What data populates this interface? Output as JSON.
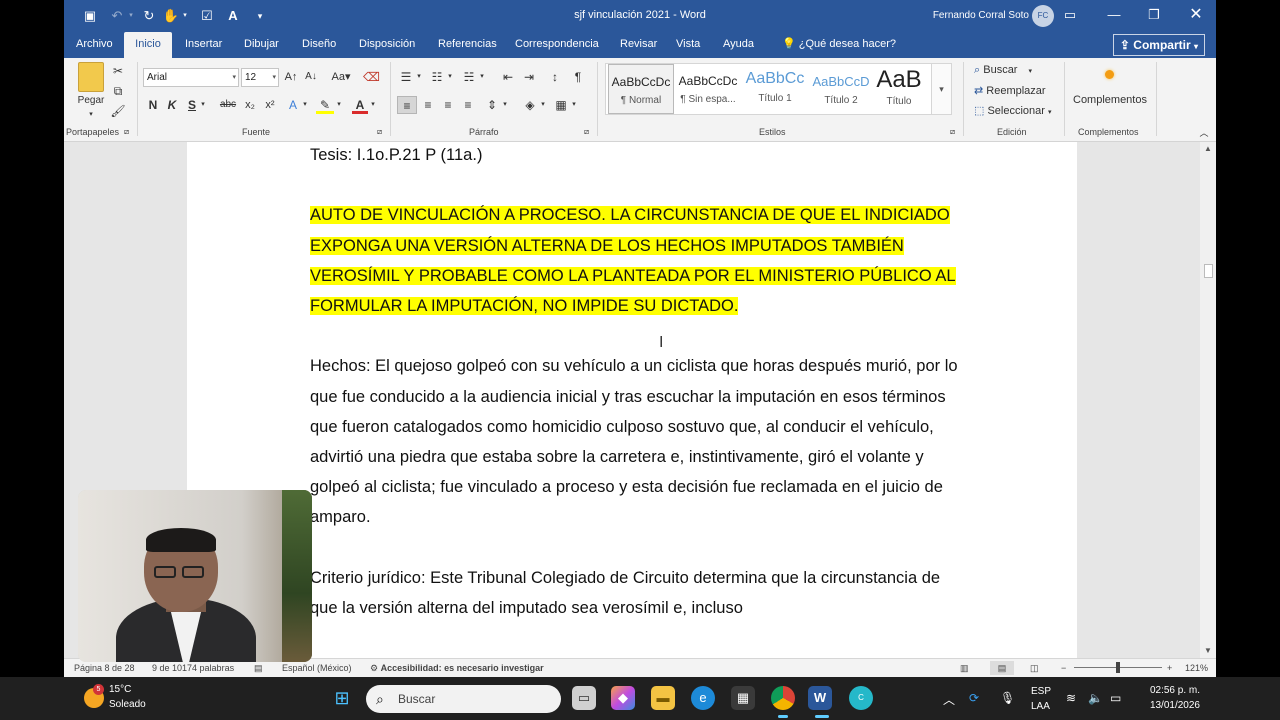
{
  "window": {
    "title": "sjf vinculación 2021  -  Word",
    "user_name": "Fernando Corral Soto",
    "user_initials": "FC"
  },
  "tabs": [
    "Archivo",
    "Inicio",
    "Insertar",
    "Dibujar",
    "Diseño",
    "Disposición",
    "Referencias",
    "Correspondencia",
    "Revisar",
    "Vista",
    "Ayuda"
  ],
  "active_tab": "Inicio",
  "tell_me": "¿Qué desea hacer?",
  "share_label": "Compartir",
  "ribbon": {
    "clipboard": {
      "paste_label": "Pegar",
      "group_label": "Portapapeles"
    },
    "font": {
      "font_name": "Arial",
      "font_size": "12",
      "bold": "N",
      "italic": "K",
      "underline": "S",
      "strike": "abc",
      "subscript": "x₂",
      "superscript": "x²",
      "group_label": "Fuente"
    },
    "paragraph": {
      "group_label": "Párrafo"
    },
    "styles": {
      "group_label": "Estilos",
      "items": [
        {
          "sample": "AaBbCcDc",
          "name": "¶ Normal"
        },
        {
          "sample": "AaBbCcDc",
          "name": "¶ Sin espa..."
        },
        {
          "sample": "AaBbCc",
          "name": "Título 1"
        },
        {
          "sample": "AaBbCcD",
          "name": "Título 2"
        },
        {
          "sample": "AaB",
          "name": "Título"
        }
      ]
    },
    "editing": {
      "group_label": "Edición",
      "find": "Buscar",
      "replace": "Reemplazar",
      "select": "Seleccionar"
    },
    "addins": {
      "label": "Complementos",
      "group_label": "Complementos"
    }
  },
  "document": {
    "paragraphs": [
      {
        "text": "Tesis: I.1o.P.21 P (11a.)",
        "highlight": false
      },
      {
        "text": "AUTO DE VINCULACIÓN A PROCESO. LA CIRCUNSTANCIA DE QUE EL INDICIADO EXPONGA UNA VERSIÓN ALTERNA DE LOS HECHOS IMPUTADOS TAMBIÉN VEROSÍMIL Y PROBABLE COMO LA PLANTEADA POR EL MINISTERIO PÚBLICO AL FORMULAR LA IMPUTACIÓN, NO IMPIDE SU DICTADO.",
        "highlight": true
      },
      {
        "text": "Hechos: El quejoso golpeó con su vehículo a un ciclista que horas después murió, por lo que fue conducido a la audiencia inicial y tras escuchar la imputación en esos términos que fueron catalogados como homicidio culposo sostuvo que, al conducir el vehículo, advirtió una piedra que estaba sobre la carretera e, instintivamente, giró el volante y golpeó al ciclista; fue vinculado a proceso y esta decisión fue reclamada en el juicio de amparo.",
        "highlight": false
      },
      {
        "text": "Criterio jurídico: Este Tribunal Colegiado de Circuito determina que la circunstancia de que la versión alterna del imputado sea verosímil e, incluso",
        "highlight": false
      }
    ]
  },
  "status": {
    "page": "Página 8 de 28",
    "words": "9 de 10174 palabras",
    "language": "Español (México)",
    "accessibility": "Accesibilidad: es necesario investigar",
    "zoom": "121%"
  },
  "taskbar": {
    "weather_temp": "15°C",
    "weather_desc": "Soleado",
    "weather_badge": "5",
    "search_placeholder": "Buscar",
    "lang_top": "ESP",
    "lang_bottom": "LAA",
    "time": "02:56 p. m.",
    "date": "13/01/2026"
  },
  "colors": {
    "word_blue": "#2b579a",
    "highlight": "#ffff00",
    "taskbar": "#202020"
  }
}
